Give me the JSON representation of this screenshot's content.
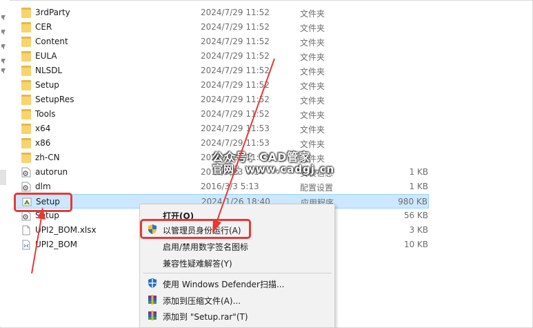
{
  "files": [
    {
      "name": "3rdParty",
      "date": "2024/7/29 11:52",
      "type": "文件夹",
      "size": "",
      "icon": "folder-icon"
    },
    {
      "name": "CER",
      "date": "2024/7/29 11:52",
      "type": "文件夹",
      "size": "",
      "icon": "folder-icon"
    },
    {
      "name": "Content",
      "date": "2024/7/29 11:52",
      "type": "文件夹",
      "size": "",
      "icon": "folder-icon"
    },
    {
      "name": "EULA",
      "date": "2024/7/29 11:52",
      "type": "文件夹",
      "size": "",
      "icon": "folder-icon"
    },
    {
      "name": "NLSDL",
      "date": "2024/7/29 11:52",
      "type": "文件夹",
      "size": "",
      "icon": "folder-icon"
    },
    {
      "name": "Setup",
      "date": "2024/7/29 11:52",
      "type": "文件夹",
      "size": "",
      "icon": "folder-icon"
    },
    {
      "name": "SetupRes",
      "date": "2024/7/29 11:52",
      "type": "文件夹",
      "size": "",
      "icon": "folder-icon"
    },
    {
      "name": "Tools",
      "date": "2024/7/29 11:52",
      "type": "文件夹",
      "size": "",
      "icon": "folder-icon"
    },
    {
      "name": "x64",
      "date": "2024/7/29 11:53",
      "type": "文件夹",
      "size": "",
      "icon": "folder-icon"
    },
    {
      "name": "x86",
      "date": "2024/7/29 11:53",
      "type": "文件夹",
      "size": "",
      "icon": "folder-icon"
    },
    {
      "name": "zh-CN",
      "date": "2024/7/29 11:53",
      "type": "文件夹",
      "size": "",
      "icon": "folder-icon"
    },
    {
      "name": "autorun",
      "date": "2016/9/23 6:14",
      "type": "安装信息",
      "size": "1 KB",
      "icon": "gear-file-icon"
    },
    {
      "name": "dlm",
      "date": "2016/3/3 5:13",
      "type": "配置设置",
      "size": "1 KB",
      "icon": "gear-file-icon"
    },
    {
      "name": "Setup",
      "date": "2024/1/26 18:40",
      "type": "应用程序",
      "size": "980 KB",
      "icon": "setup-app-icon"
    },
    {
      "name": "Setup",
      "date": "",
      "type": "",
      "size": "56 KB",
      "icon": "gear-file-icon"
    },
    {
      "name": "UPI2_BOM.xlsx",
      "date": "",
      "type": "件",
      "size": "3 KB",
      "icon": "document-icon"
    },
    {
      "name": "UPI2_BOM",
      "date": "",
      "type": "",
      "size": "10 KB",
      "icon": "xml-file-icon"
    }
  ],
  "watermark": {
    "line1": "公众号：CAD管家",
    "line2": "官网：www.cadgj.cn"
  },
  "context_menu": {
    "open": "打开(O)",
    "run_as_admin": "以管理员身份运行(A)",
    "toggle_signature": "启用/禁用数字签名图标",
    "compat": "兼容性疑难解答(Y)",
    "defender": "使用 Windows Defender扫描...",
    "add_archive": "添加到压缩文件(A)...",
    "add_rar": "添加到 \"Setup.rar\"(T)"
  },
  "colors": {
    "selection_bg": "#cce8ff",
    "selection_border": "#99d1ff",
    "highlight_red": "#e53935"
  }
}
